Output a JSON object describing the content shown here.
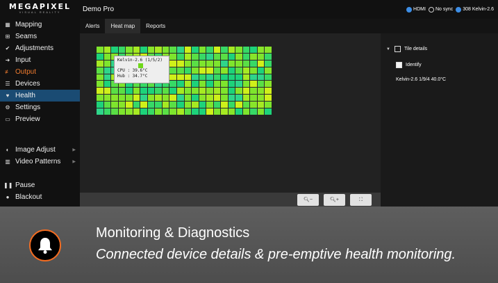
{
  "brand": {
    "name": "MEGAPIXEL",
    "tagline": "VISUAL REALITY"
  },
  "project_title": "Demo Pro",
  "status": {
    "hdmi": "HDMI",
    "no_sync": "No sync",
    "devices": "308 Kelvin-2.6"
  },
  "tabs": [
    {
      "label": "Alerts"
    },
    {
      "label": "Heat map"
    },
    {
      "label": "Reports"
    }
  ],
  "sidebar": {
    "items": [
      {
        "label": "Mapping",
        "icon": "grid-icon"
      },
      {
        "label": "Seams",
        "icon": "seams-icon"
      },
      {
        "label": "Adjustments",
        "icon": "wrench-icon"
      },
      {
        "label": "Input",
        "icon": "input-icon"
      },
      {
        "label": "Output",
        "icon": "output-icon"
      },
      {
        "label": "Devices",
        "icon": "list-icon"
      },
      {
        "label": "Health",
        "icon": "heart-icon"
      },
      {
        "label": "Settings",
        "icon": "gears-icon"
      },
      {
        "label": "Preview",
        "icon": "monitor-icon"
      },
      {
        "label": "Image Adjust",
        "icon": "contrast-icon"
      },
      {
        "label": "Video Patterns",
        "icon": "bars-icon"
      },
      {
        "label": "Pause",
        "icon": "pause-icon"
      },
      {
        "label": "Blackout",
        "icon": "bulb-icon"
      }
    ]
  },
  "tooltip": {
    "device": "Kelvin-2.6 (1/5/2)",
    "cpu": "CPU : 39.6°C",
    "hub": "Hub : 34.7°C"
  },
  "right_panel": {
    "tile_details": "Tile details",
    "identify": "Identify",
    "info": "Kelvin-2.6 1/9/4 40.0°C"
  },
  "banner": {
    "title": "Monitoring & Diagnostics",
    "subtitle": "Connected device details & pre-emptive health monitoring."
  },
  "colors": {
    "accent_orange": "#f07b2e",
    "active_blue": "#1a4b73",
    "status_blue": "#3d8ee6",
    "heat_cool": "#1dd37a",
    "heat_warm": "#cff01a"
  }
}
